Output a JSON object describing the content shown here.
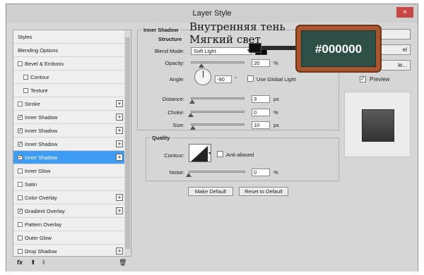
{
  "window": {
    "title": "Layer Style",
    "close_glyph": "×"
  },
  "left_panel": {
    "items": [
      {
        "label": "Styles",
        "has_checkbox": false,
        "checked": false,
        "has_plus": false,
        "selected": false,
        "indent": false
      },
      {
        "label": "Blending Options",
        "has_checkbox": false,
        "checked": false,
        "has_plus": false,
        "selected": false,
        "indent": false
      },
      {
        "label": "Bevel & Emboss",
        "has_checkbox": true,
        "checked": false,
        "has_plus": false,
        "selected": false,
        "indent": false
      },
      {
        "label": "Contour",
        "has_checkbox": true,
        "checked": false,
        "has_plus": false,
        "selected": false,
        "indent": true
      },
      {
        "label": "Texture",
        "has_checkbox": true,
        "checked": false,
        "has_plus": false,
        "selected": false,
        "indent": true
      },
      {
        "label": "Stroke",
        "has_checkbox": true,
        "checked": false,
        "has_plus": true,
        "selected": false,
        "indent": false
      },
      {
        "label": "Inner Shadow",
        "has_checkbox": true,
        "checked": true,
        "has_plus": true,
        "selected": false,
        "indent": false
      },
      {
        "label": "Inner Shadow",
        "has_checkbox": true,
        "checked": true,
        "has_plus": true,
        "selected": false,
        "indent": false
      },
      {
        "label": "Inner Shadow",
        "has_checkbox": true,
        "checked": true,
        "has_plus": true,
        "selected": false,
        "indent": false
      },
      {
        "label": "Inner Shadow",
        "has_checkbox": true,
        "checked": true,
        "has_plus": true,
        "selected": true,
        "indent": false
      },
      {
        "label": "Inner Glow",
        "has_checkbox": true,
        "checked": false,
        "has_plus": false,
        "selected": false,
        "indent": false
      },
      {
        "label": "Satin",
        "has_checkbox": true,
        "checked": false,
        "has_plus": false,
        "selected": false,
        "indent": false
      },
      {
        "label": "Color Overlay",
        "has_checkbox": true,
        "checked": false,
        "has_plus": true,
        "selected": false,
        "indent": false
      },
      {
        "label": "Gradient Overlay",
        "has_checkbox": true,
        "checked": true,
        "has_plus": true,
        "selected": false,
        "indent": false
      },
      {
        "label": "Pattern Overlay",
        "has_checkbox": true,
        "checked": false,
        "has_plus": false,
        "selected": false,
        "indent": false
      },
      {
        "label": "Outer Glow",
        "has_checkbox": true,
        "checked": false,
        "has_plus": false,
        "selected": false,
        "indent": false
      },
      {
        "label": "Drop Shadow",
        "has_checkbox": true,
        "checked": false,
        "has_plus": true,
        "selected": false,
        "indent": false
      }
    ],
    "toolbar": {
      "fx": "fx",
      "up": "⬆",
      "down": "⬇",
      "trash": "🗑"
    }
  },
  "inner_shadow": {
    "section_title": "Inner Shadow",
    "structure_title": "Structure",
    "blend_mode": {
      "label": "Blend Mode:",
      "value": "Soft Light",
      "color": "#000000"
    },
    "opacity": {
      "label": "Opacity:",
      "value": "20",
      "unit": "%",
      "level": 0.2
    },
    "angle": {
      "label": "Angle:",
      "value": "-90",
      "unit": "°",
      "use_global_light_label": "Use Global Light",
      "use_global_light": false
    },
    "distance": {
      "label": "Distance:",
      "value": "3",
      "unit": "px",
      "level": 0.03
    },
    "choke": {
      "label": "Choke:",
      "value": "0",
      "unit": "%",
      "level": 0
    },
    "size": {
      "label": "Size:",
      "value": "10",
      "unit": "px",
      "level": 0.04
    },
    "quality_title": "Quality",
    "contour": {
      "label": "Contour:",
      "anti_aliased_label": "Anti-aliased",
      "anti_aliased": false
    },
    "noise": {
      "label": "Noise:",
      "value": "0",
      "unit": "%",
      "level": 0
    },
    "make_default": "Make Default",
    "reset_default": "Reset to Default"
  },
  "right_panel": {
    "buttons": [
      "",
      "el",
      "le..."
    ],
    "preview_label": "Preview",
    "preview_checked": true
  },
  "overlay": {
    "line1": "Внутренняя тень",
    "line2": "Мягкий свет",
    "badge_text": "#000000",
    "badge_color": "#2f5047"
  },
  "colors": {
    "selected": "#3f9cf2",
    "dialog_bg": "#d6d6d6"
  }
}
